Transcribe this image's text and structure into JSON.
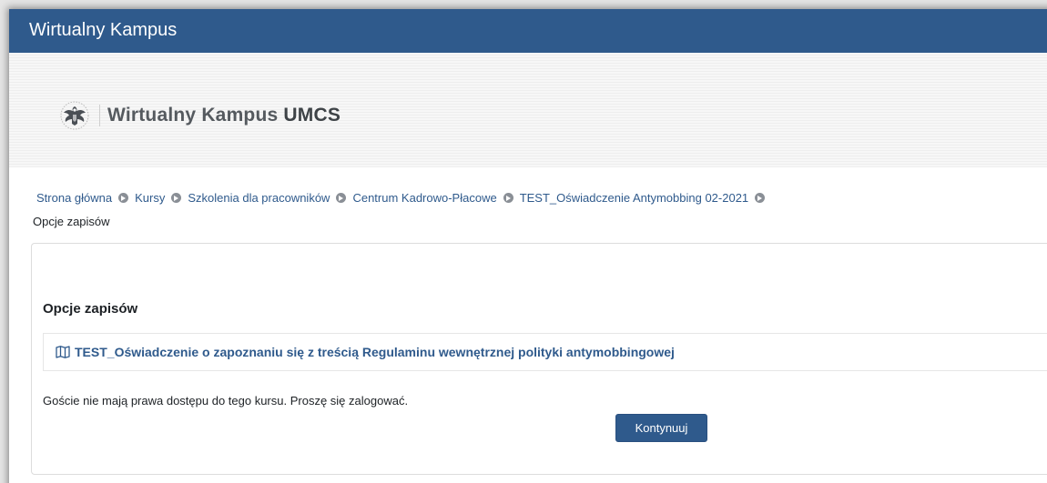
{
  "topbar": {
    "title": "Wirtualny Kampus"
  },
  "brand": {
    "name_regular": "Wirtualny Kampus ",
    "name_bold": "UMCS"
  },
  "breadcrumb": {
    "items": [
      "Strona główna",
      "Kursy",
      "Szkolenia dla pracowników",
      "Centrum Kadrowo-Płacowe",
      "TEST_Oświadczenie Antymobbing 02-2021"
    ],
    "current": "Opcje zapisów"
  },
  "main": {
    "heading": "Opcje zapisów",
    "course_title": "TEST_Oświadczenie o zapoznaniu się z treścią Regulaminu wewnętrznej polityki antymobbingowej",
    "guest_message": "Goście nie mają prawa dostępu do tego kursu. Proszę się zalogować.",
    "continue_label": "Kontynuuj"
  },
  "colors": {
    "topbar": "#2f5a8c",
    "link": "#2f5a8c",
    "button": "#2f5a8c",
    "separator": "#8a8f96"
  },
  "icons": {
    "logo": "eagle-emblem-icon",
    "breadcrumb_separator": "chevron-circle-right-icon",
    "course": "map-icon"
  }
}
